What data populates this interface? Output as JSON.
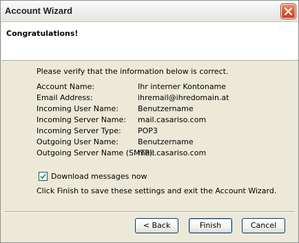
{
  "window": {
    "title": "Account Wizard",
    "close_icon": "close-icon"
  },
  "header": {
    "title": "Congratulations!"
  },
  "content": {
    "intro": "Please verify that the information below is correct.",
    "rows": [
      {
        "label": "Account Name:",
        "value": "Ihr interner Kontoname"
      },
      {
        "label": "Email Address:",
        "value": "ihremail@ihredomain.at"
      },
      {
        "label": "Incoming User Name:",
        "value": "Benutzername"
      },
      {
        "label": "Incoming Server Name:",
        "value": "mail.casariso.com"
      },
      {
        "label": "Incoming Server Type:",
        "value": "POP3"
      },
      {
        "label": "Outgoing User Name:",
        "value": "Benutzername"
      },
      {
        "label": "Outgoing Server Name (SMTP):",
        "value": "mail.casariso.com"
      }
    ],
    "download_checkbox": {
      "label": "Download messages now",
      "checked": true
    },
    "finish_hint": "Click Finish to save these settings and exit the Account Wizard."
  },
  "buttons": {
    "back": "< Back",
    "finish": "Finish",
    "cancel": "Cancel"
  },
  "colors": {
    "accent": "#1c5180",
    "close": "#d55a34",
    "header_bg": "#ffffff",
    "dialog_bg": "#ece9d8"
  }
}
